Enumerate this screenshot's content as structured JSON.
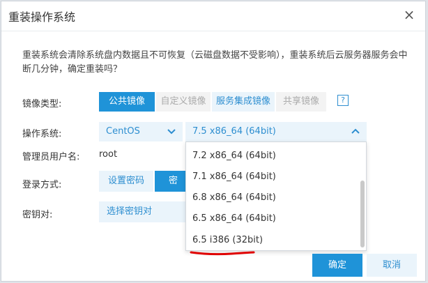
{
  "dialog": {
    "title": "重装操作系统",
    "close_glyph": "×",
    "warning": "重装系统会清除系统盘内数据且不可恢复（云磁盘数据不受影响），重装系统后云服务器服务会中断几分钟，确定重装吗？"
  },
  "image_type": {
    "label": "镜像类型:",
    "options": [
      "公共镜像",
      "自定义镜像",
      "服务集成镜像",
      "共享镜像"
    ],
    "help_glyph": "?"
  },
  "os": {
    "label": "操作系统:",
    "distro": "CentOS",
    "version": "7.5 x86_64 (64bit)",
    "dropdown_options": [
      "7.2 x86_64 (64bit)",
      "7.1 x86_64 (64bit)",
      "6.8 x86_64 (64bit)",
      "6.5 x86_64 (64bit)",
      "6.5 i386 (32bit)"
    ]
  },
  "admin_user": {
    "label": "管理员用户名:",
    "value": "root"
  },
  "login_method": {
    "label": "登录方式:",
    "options": [
      "设置密码",
      "密钥"
    ]
  },
  "key_pair": {
    "label": "密钥对:",
    "button": "选择密钥对"
  },
  "footer": {
    "confirm": "确定",
    "cancel": "取消"
  },
  "colors": {
    "primary": "#1f93d8",
    "light": "#eaf4fb",
    "annotation": "#e00000"
  }
}
